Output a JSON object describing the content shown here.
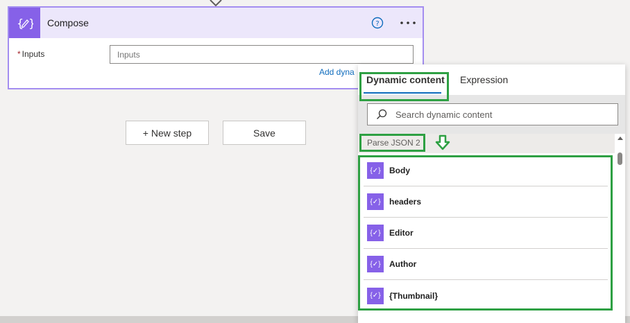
{
  "compose": {
    "title": "Compose",
    "inputs_label": "Inputs",
    "inputs_required": "*",
    "inputs_placeholder": "Inputs",
    "add_dynamic_link": "Add dyna"
  },
  "buttons": {
    "new_step": "+ New step",
    "save": "Save"
  },
  "panel": {
    "tabs": [
      "Dynamic content",
      "Expression"
    ],
    "search_placeholder": "Search dynamic content",
    "section_label": "Parse JSON 2",
    "items": [
      {
        "label": "Body",
        "icon": "parse-json-icon"
      },
      {
        "label": "headers",
        "icon": "parse-json-icon"
      },
      {
        "label": "Editor",
        "icon": "parse-json-icon"
      },
      {
        "label": "Author",
        "icon": "parse-json-icon"
      },
      {
        "label": "{Thumbnail}",
        "icon": "parse-json-icon"
      }
    ]
  },
  "colors": {
    "accent_purple": "#8661e8",
    "card_border": "#a48ef0",
    "link_blue": "#0f6cbd",
    "highlight_green": "#2ea043"
  }
}
